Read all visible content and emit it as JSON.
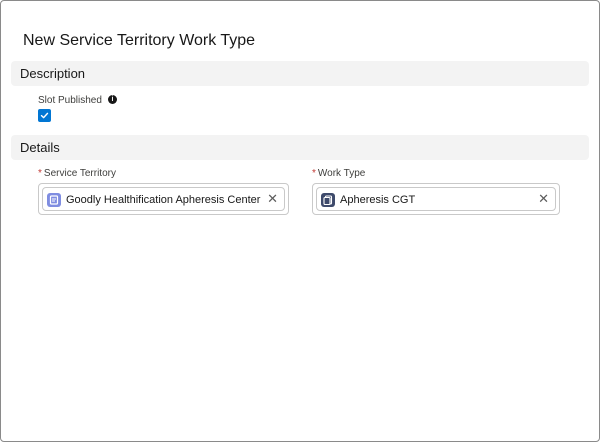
{
  "modal": {
    "title": "New Service Territory Work Type"
  },
  "sections": {
    "description": {
      "label": "Description"
    },
    "details": {
      "label": "Details"
    }
  },
  "fields": {
    "slot_published": {
      "label": "Slot Published",
      "checked": true,
      "info_icon": "info-icon"
    },
    "service_territory": {
      "required_mark": "*",
      "label": "Service Territory",
      "value": "Goodly Healthification Apheresis Center",
      "icon": "service-territory-icon",
      "icon_color": "#7f8de1"
    },
    "work_type": {
      "required_mark": "*",
      "label": "Work Type",
      "value": "Apheresis CGT",
      "icon": "work-type-icon",
      "icon_color": "#3e4a6b"
    }
  },
  "colors": {
    "checkbox": "#0176d3",
    "required": "#c23934",
    "section_bg": "#f3f3f3"
  }
}
